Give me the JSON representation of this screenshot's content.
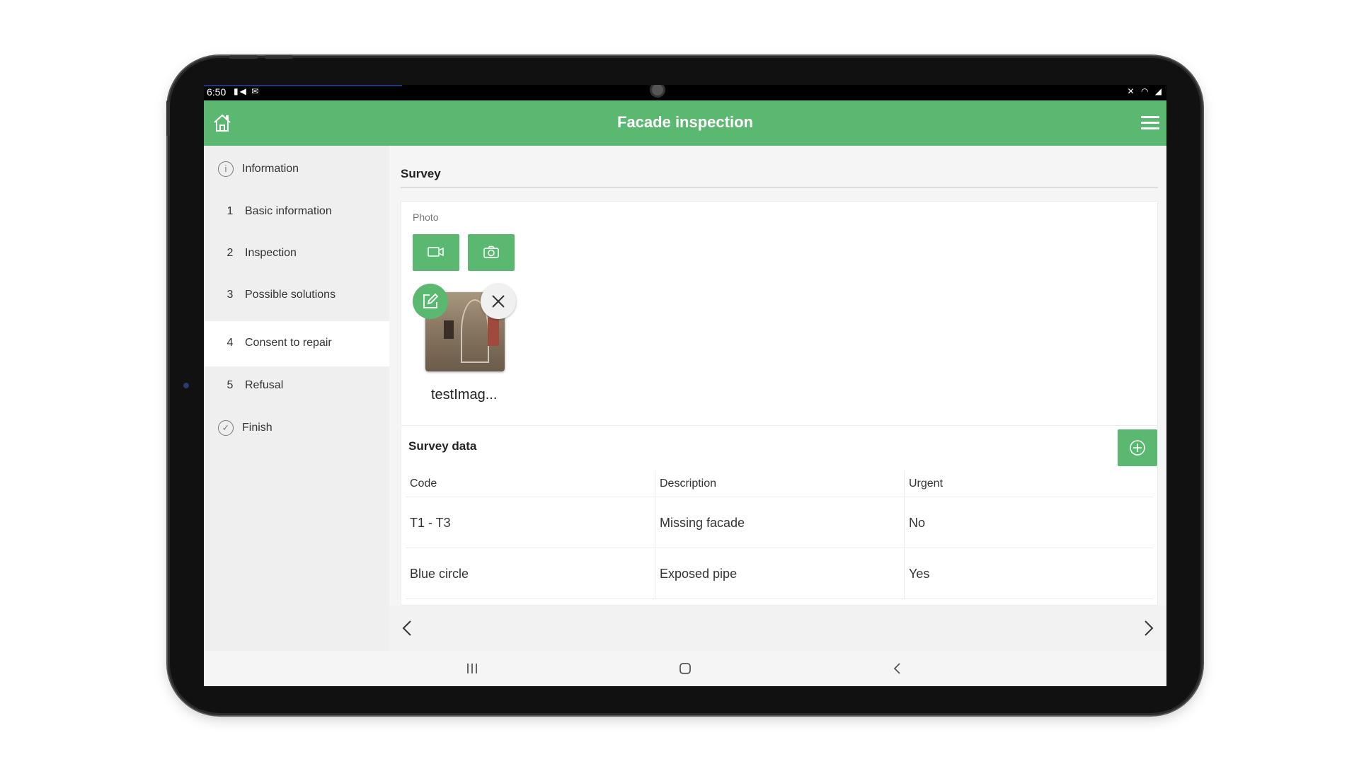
{
  "status_bar": {
    "time": "6:50",
    "left_icons": [
      "video-icon",
      "gmail-icon"
    ],
    "right_icons": [
      "mute-icon",
      "wifi-icon",
      "battery-icon"
    ]
  },
  "header": {
    "title": "Facade inspection",
    "home_icon": "home-icon",
    "menu_icon": "hamburger-menu-icon",
    "accent_color": "#5bb870"
  },
  "sidebar": {
    "items": [
      {
        "number": "",
        "label": "Information",
        "icon": "info-icon",
        "active": false
      },
      {
        "number": "1",
        "label": "Basic information",
        "active": false
      },
      {
        "number": "2",
        "label": "Inspection",
        "active": false
      },
      {
        "number": "3",
        "label": "Possible solutions",
        "active": false
      },
      {
        "number": "4",
        "label": "Consent to repair",
        "active": true
      },
      {
        "number": "5",
        "label": "Refusal",
        "active": false
      },
      {
        "number": "",
        "label": "Finish",
        "icon": "check-circle-icon",
        "active": false
      }
    ]
  },
  "survey": {
    "title": "Survey",
    "photo_label": "Photo",
    "video_button_icon": "video-camera-icon",
    "photo_button_icon": "camera-icon",
    "thumbnail_name": "testImag..."
  },
  "survey_data": {
    "title": "Survey data",
    "add_icon": "plus-circle-icon",
    "columns": [
      "Code",
      "Description",
      "Urgent"
    ],
    "rows": [
      [
        "T1 - T3",
        "Missing facade",
        "No"
      ],
      [
        "Blue circle",
        "Exposed pipe",
        "Yes"
      ]
    ]
  },
  "pager": {
    "prev_icon": "chevron-left-icon",
    "next_icon": "chevron-right-icon"
  },
  "nav_bar": {
    "icons": [
      "recent-apps-icon",
      "home-circle-icon",
      "back-icon"
    ]
  }
}
